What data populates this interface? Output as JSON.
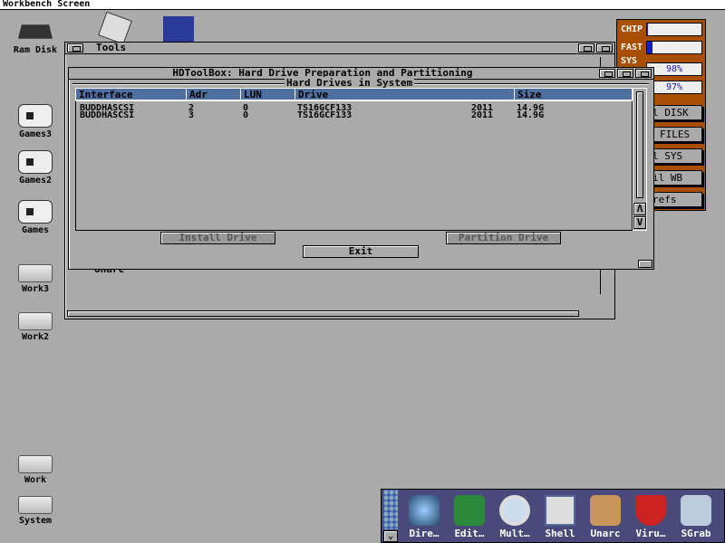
{
  "screen": {
    "title": "Workbench Screen"
  },
  "desktop_icons": [
    {
      "label": "Ram Disk",
      "icon": "ram-disk-icon"
    },
    {
      "label": "Games3",
      "icon": "gamepad-icon"
    },
    {
      "label": "Games2",
      "icon": "gamepad-icon"
    },
    {
      "label": "Games",
      "icon": "gamepad-icon"
    },
    {
      "label": "Work3",
      "icon": "harddisk-icon"
    },
    {
      "label": "Work2",
      "icon": "harddisk-icon"
    },
    {
      "label": "Work",
      "icon": "harddisk-icon"
    },
    {
      "label": "System",
      "icon": "harddisk-icon"
    }
  ],
  "tools_window": {
    "title": "Tools",
    "visible_item": "Unarc"
  },
  "hdtoolbox": {
    "title": "HDToolBox: Hard Drive Preparation and Partitioning",
    "group": "Hard Drives in System",
    "columns": [
      "Interface",
      "Adr",
      "LUN",
      "Drive",
      "Size"
    ],
    "rows": [
      {
        "interface": "BUDDHASCSI",
        "adr": "2",
        "lun": "0",
        "drive": "TS16GCF133",
        "rev": "2011",
        "size": "14.9G"
      },
      {
        "interface": "BUDDHASCSI",
        "adr": "3",
        "lun": "0",
        "drive": "TS16GCF133",
        "rev": "2011",
        "size": "14.9G"
      }
    ],
    "install_label": "Install Drive",
    "partition_label": "Partition Drive",
    "exit_label": "Exit",
    "header_color": "#4f6fa0"
  },
  "monitor": {
    "chip_label": "CHIP",
    "fast_label": "FAST",
    "sys_label": "SYS",
    "chip_fill": 0.02,
    "fast_fill": 0.1,
    "sys_value": "98%",
    "other_value": "97%",
    "buttons": [
      "l DISK",
      "FILES",
      "l SYS",
      "il WB",
      "refs"
    ],
    "color": "#a85000"
  },
  "dock": {
    "items": [
      "Dire…",
      "Edit…",
      "Mult…",
      "Shell",
      "Unarc",
      "Viru…",
      "SGrab"
    ]
  }
}
